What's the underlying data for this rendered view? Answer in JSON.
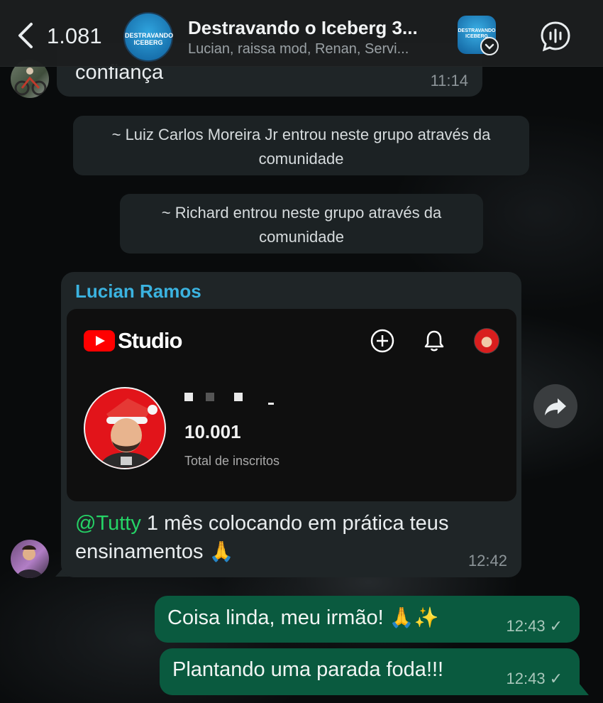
{
  "header": {
    "back_count": "1.081",
    "group_title": "Destravando o Iceberg 3...",
    "group_subtitle": "Lucian, raissa mod, Renan, Servi...",
    "avatar_text": "DESTRAVANDO ICEBERG"
  },
  "messages": {
    "m1": {
      "text": "confiança",
      "time": "11:14"
    },
    "sys1": "~ Luiz Carlos Moreira Jr entrou neste grupo através da comunidade",
    "sys2": "~ Richard entrou neste grupo através da comunidade",
    "m2": {
      "sender": "Lucian Ramos",
      "mention": "@Tutty",
      "text": " 1 mês colocando em prática teus ensinamentos ",
      "emoji": "🙏",
      "time": "12:42",
      "screenshot": {
        "app_name": "Studio",
        "subscriber_count": "10.001",
        "subscriber_label": "Total de inscritos"
      }
    },
    "m3": {
      "text": "Coisa linda, meu irmão! ",
      "emoji1": "🙏",
      "emoji2": "✨",
      "time": "12:43",
      "status": "✓"
    },
    "m4": {
      "text": "Plantando uma parada foda!!!",
      "time": "12:43",
      "status": "✓"
    }
  },
  "colors": {
    "sender_name": "#3bb3e0",
    "mention": "#25d366",
    "outgoing_bubble": "#0a5a3f",
    "incoming_bubble": "#1f2527"
  },
  "icons": [
    "back-icon",
    "voice-call-icon",
    "forward-icon",
    "youtube-logo-icon",
    "create-icon",
    "bell-icon"
  ]
}
